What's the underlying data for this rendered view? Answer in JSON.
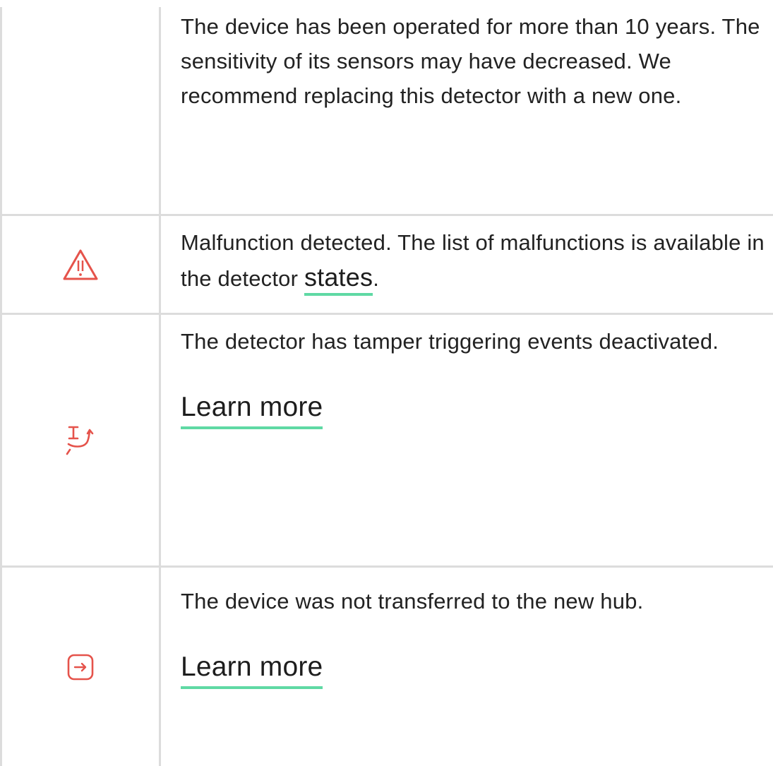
{
  "rows": [
    {
      "text": "The device has been operated for more than 10 years. The sensitivity of its sensors may have decreased. We recommend replacing this detector with a new one."
    },
    {
      "icon": "warning-triangle-icon",
      "text_before": "Malfunction detected. The list of malfunctions is available in the detector ",
      "link": "states",
      "text_after": "."
    },
    {
      "icon": "tamper-disabled-icon",
      "text": "The detector has tamper triggering events deactivated.",
      "link": "Learn more"
    },
    {
      "icon": "transfer-arrow-icon",
      "text": "The device was not transferred to the new hub.",
      "link": "Learn more"
    }
  ],
  "colors": {
    "icon": "#e5534b",
    "link_underline": "#5fd9a4",
    "border": "#dcdcdc"
  }
}
